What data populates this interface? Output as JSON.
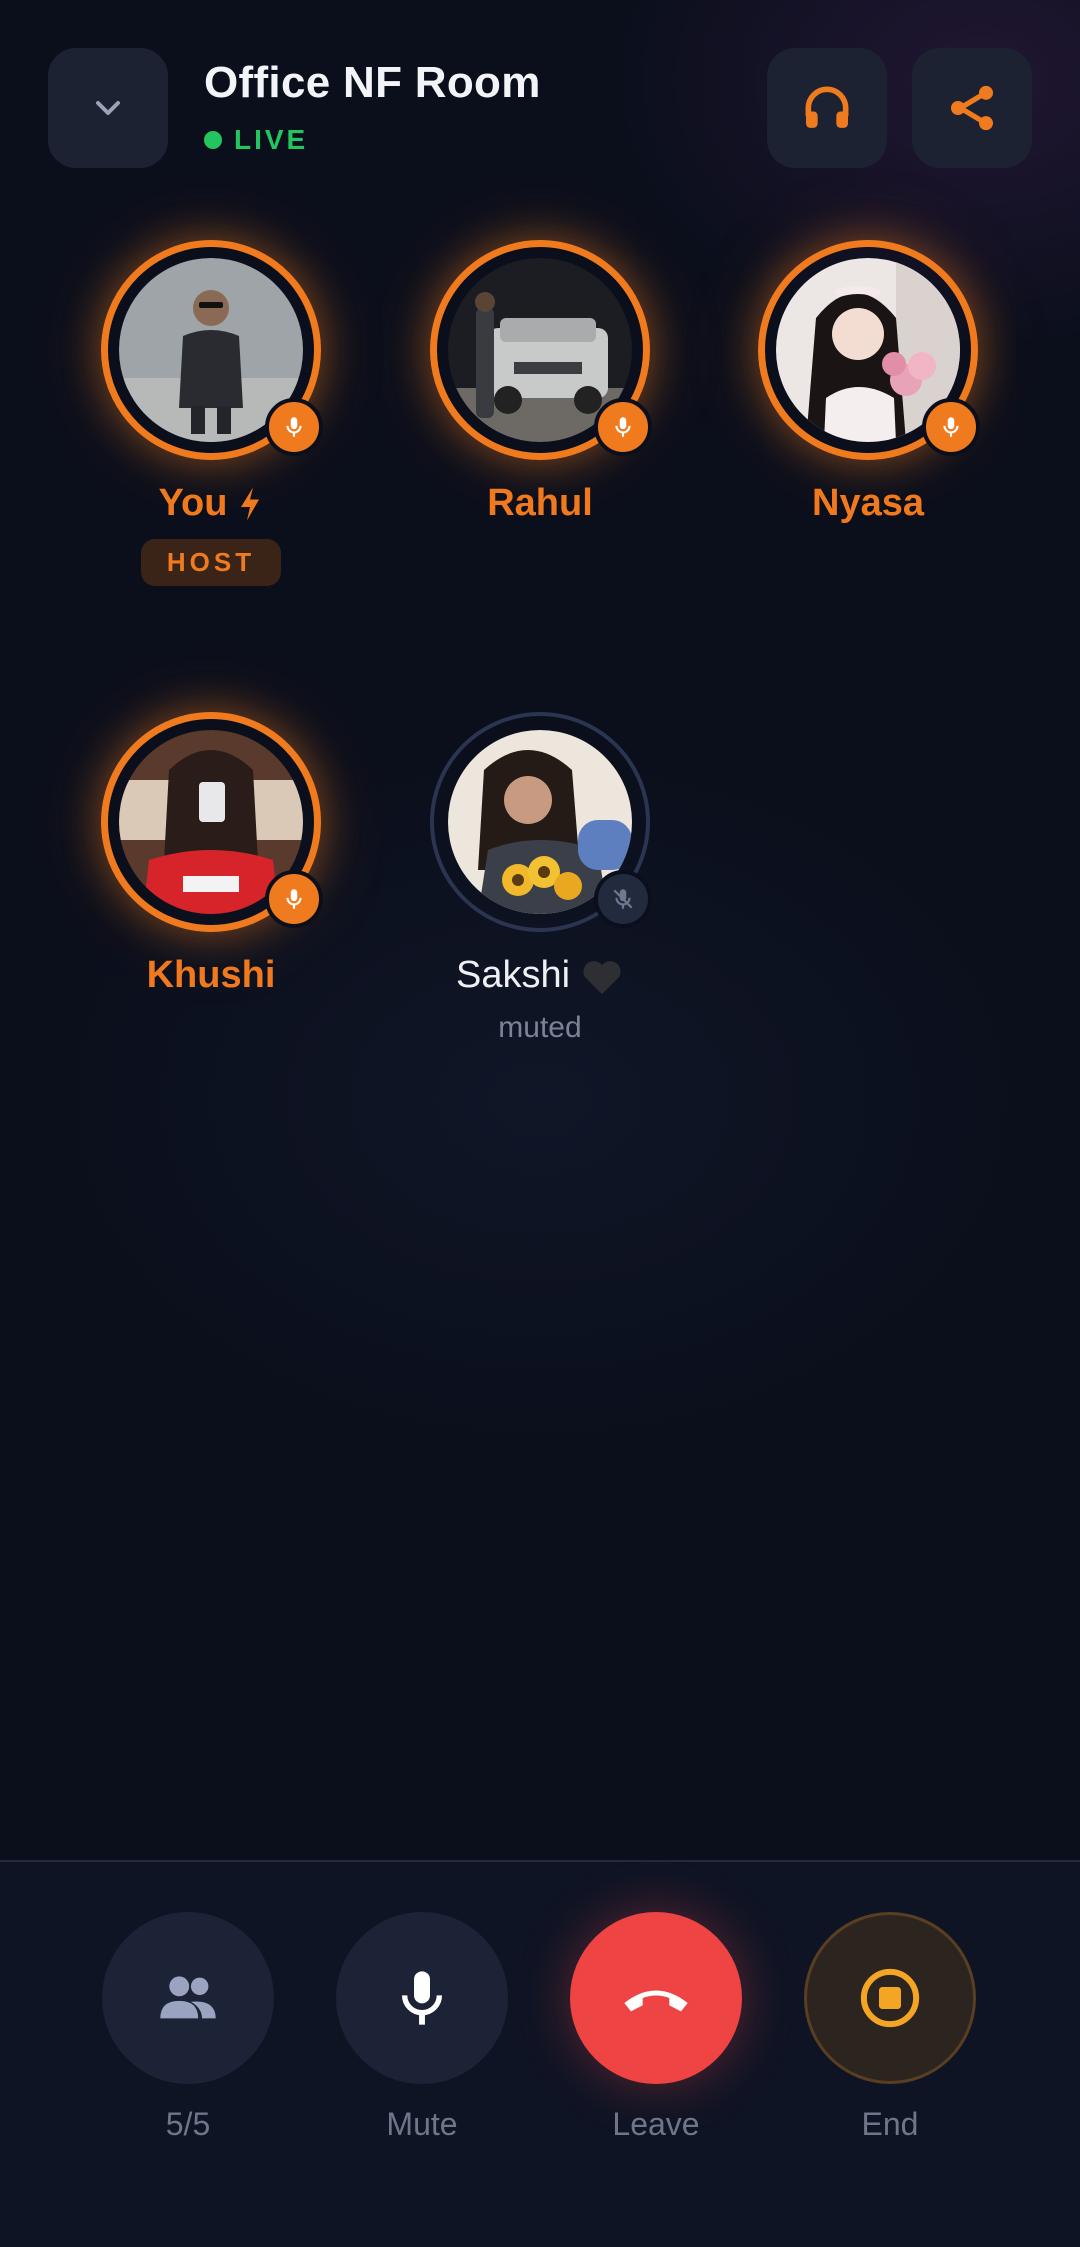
{
  "header": {
    "title": "Office NF Room",
    "live_label": "LIVE",
    "back_icon": "chevron-down-icon",
    "audio_icon": "headphones-icon",
    "share_icon": "share-icon"
  },
  "participants": [
    {
      "name": "You",
      "role_badge": "HOST",
      "state": "speaking",
      "extra_icon": "lightning-icon"
    },
    {
      "name": "Rahul",
      "state": "speaking"
    },
    {
      "name": "Nyasa",
      "state": "speaking"
    },
    {
      "name": "Khushi",
      "state": "speaking"
    },
    {
      "name": "Sakshi",
      "state": "muted",
      "status_text": "muted",
      "extra_icon": "black-heart-icon"
    }
  ],
  "controls": [
    {
      "label": "5/5",
      "icon": "people-icon"
    },
    {
      "label": "Mute",
      "icon": "microphone-icon"
    },
    {
      "label": "Leave",
      "icon": "hang-up-icon"
    },
    {
      "label": "End",
      "icon": "stop-icon"
    }
  ],
  "colors": {
    "background": "#0b0f1c",
    "accent": "#f07a1e",
    "live": "#22c55e",
    "leave": "#ef4444",
    "button_bg": "#1c2232"
  }
}
